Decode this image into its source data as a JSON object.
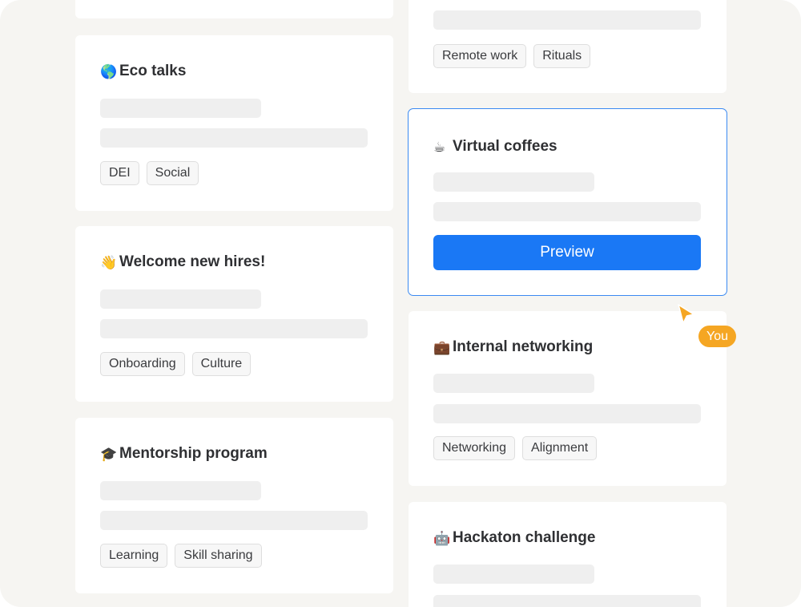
{
  "cards": {
    "top_left": {},
    "remote": {
      "tags": [
        "Remote work",
        "Rituals"
      ]
    },
    "eco": {
      "emoji": "🌎",
      "title": "Eco talks",
      "tags": [
        "DEI",
        "Social"
      ]
    },
    "virtual": {
      "emoji": "☕",
      "title": "Virtual coffees",
      "button_label": "Preview"
    },
    "welcome": {
      "emoji": "👋",
      "title": "Welcome new hires!",
      "tags": [
        "Onboarding",
        "Culture"
      ]
    },
    "networking": {
      "emoji": "💼",
      "title": "Internal networking",
      "tags": [
        "Networking",
        "Alignment"
      ]
    },
    "mentorship": {
      "emoji": "🎓",
      "title": "Mentorship program",
      "tags": [
        "Learning",
        "Skill sharing"
      ]
    },
    "hackaton": {
      "emoji": "🤖",
      "title": "Hackaton challenge"
    }
  },
  "cursor": {
    "label": "You",
    "color": "#f5a623"
  },
  "colors": {
    "accent": "#1a78f5",
    "highlight_border": "#3b8af2",
    "background": "#f6f5f2"
  }
}
